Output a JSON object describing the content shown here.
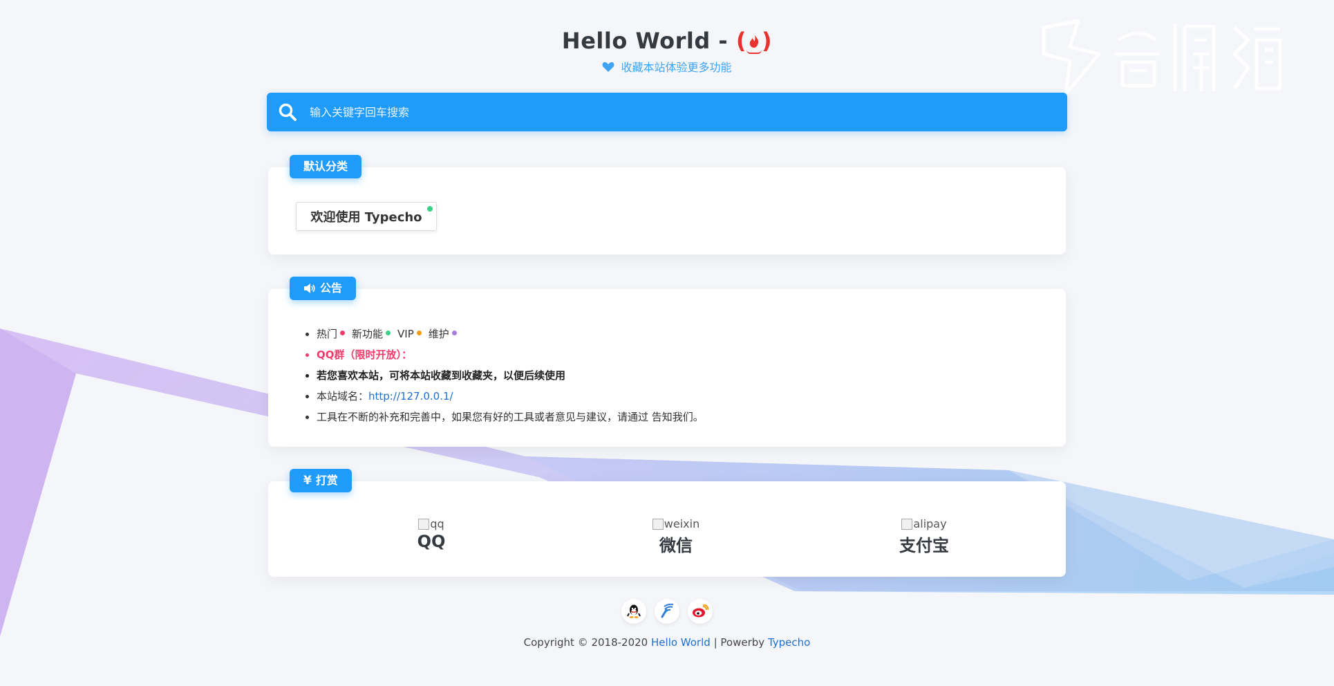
{
  "header": {
    "title": "Hello World -",
    "title_icon": "fire-icon",
    "subtitle": "收藏本站体验更多功能",
    "subtitle_icon": "heart-icon"
  },
  "search": {
    "placeholder": "输入关键字回车搜索",
    "icon": "search-icon"
  },
  "categories": {
    "tab_label": "默认分类",
    "items": [
      {
        "label": "欢迎使用 Typecho",
        "status_color": "#3bd08a"
      }
    ]
  },
  "notice": {
    "tab_label": "公告",
    "tab_icon": "speaker-icon",
    "tags": [
      {
        "label": "热门",
        "color": "#f13b6b"
      },
      {
        "label": "新功能",
        "color": "#3bd08a"
      },
      {
        "label": "VIP",
        "color": "#f39c12"
      },
      {
        "label": "维护",
        "color": "#a87cdb"
      }
    ],
    "qq_line": "QQ群（限时开放）：",
    "bookmark_line": "若您喜欢本站，可将本站收藏到收藏夹，以便后续使用",
    "domain_label": "本站域名：",
    "domain_link": "http://127.0.0.1/",
    "feedback_line": "工具在不断的补充和完善中，如果您有好的工具或者意见与建议，请通过 告知我们。"
  },
  "reward": {
    "tab_label": "打赏",
    "tab_icon": "yen-icon",
    "items": [
      {
        "img_alt": "qq",
        "title": "QQ"
      },
      {
        "img_alt": "weixin",
        "title": "微信"
      },
      {
        "img_alt": "alipay",
        "title": "支付宝"
      }
    ]
  },
  "social": {
    "icons": [
      "qq-icon",
      "antenna-icon",
      "weibo-icon"
    ]
  },
  "footer": {
    "copyright": "Copyright © 2018-2020",
    "site_link": "Hello World",
    "separator": "|",
    "powered": "Powerby",
    "powered_link": "Typecho"
  },
  "colors": {
    "accent": "#1f9bfb",
    "page_bg": "#f4f6f9",
    "link": "#1f6fd0"
  }
}
